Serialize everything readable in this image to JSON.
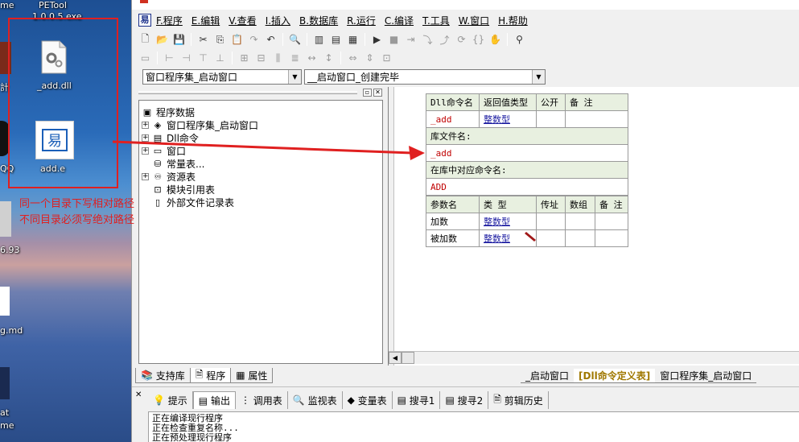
{
  "desktop": {
    "labels": [
      {
        "text": "me"
      },
      {
        "text": "PETool"
      },
      {
        "text": "1.0.0.5.exe"
      },
      {
        "text": "_add.dll"
      },
      {
        "text": "add.e"
      },
      {
        "text": "計"
      },
      {
        "text": "QQ"
      },
      {
        "text": "6.93"
      },
      {
        "text": "g.md"
      },
      {
        "text": "at"
      },
      {
        "text": "me"
      }
    ],
    "note_lines": [
      "同一个目录下写相对路径",
      "不同目录必须写绝对路径"
    ],
    "arrow_color": "#e02020"
  },
  "menu": [
    "F.程序",
    "E.编辑",
    "V.查看",
    "I.插入",
    "B.数据库",
    "R.运行",
    "C.编译",
    "T.工具",
    "W.窗口",
    "H.帮助"
  ],
  "combos": {
    "left": "窗口程序集_启动窗口",
    "right": "__启动窗口_创建完毕"
  },
  "tree": {
    "root": "程序数据",
    "items": [
      {
        "label": "窗口程序集_启动窗口",
        "expander": "+"
      },
      {
        "label": "Dll命令",
        "expander": "+"
      },
      {
        "label": "窗口",
        "expander": "+"
      },
      {
        "label": "常量表...",
        "expander": ""
      },
      {
        "label": "资源表",
        "expander": "+"
      },
      {
        "label": "模块引用表",
        "expander": ""
      },
      {
        "label": "外部文件记录表",
        "expander": ""
      }
    ]
  },
  "left_tabs": [
    "支持库",
    "程序",
    "属性"
  ],
  "dll_table": {
    "headers": [
      "Dll命令名",
      "返回值类型",
      "公开",
      "备 注"
    ],
    "row": [
      "_add",
      "整数型",
      "",
      ""
    ],
    "lib_label": "库文件名:",
    "lib_value": "_add",
    "cmd_label": "在库中对应命令名:",
    "cmd_value": "ADD",
    "param_headers": [
      "参数名",
      "类 型",
      "传址",
      "数组",
      "备 注"
    ],
    "params": [
      [
        "加数",
        "整数型",
        "",
        "",
        ""
      ],
      [
        "被加数",
        "整数型",
        "",
        "",
        ""
      ]
    ]
  },
  "right_tabs": [
    "_启动窗口",
    "[Dll命令定义表]",
    "窗口程序集_启动窗口"
  ],
  "bottom_tabs": [
    "提示",
    "输出",
    "调用表",
    "监视表",
    "变量表",
    "搜寻1",
    "搜寻2",
    "剪辑历史"
  ],
  "output_lines": [
    "正在编译现行程序",
    "正在检查重复名称...",
    "正在预处理现行程序"
  ]
}
